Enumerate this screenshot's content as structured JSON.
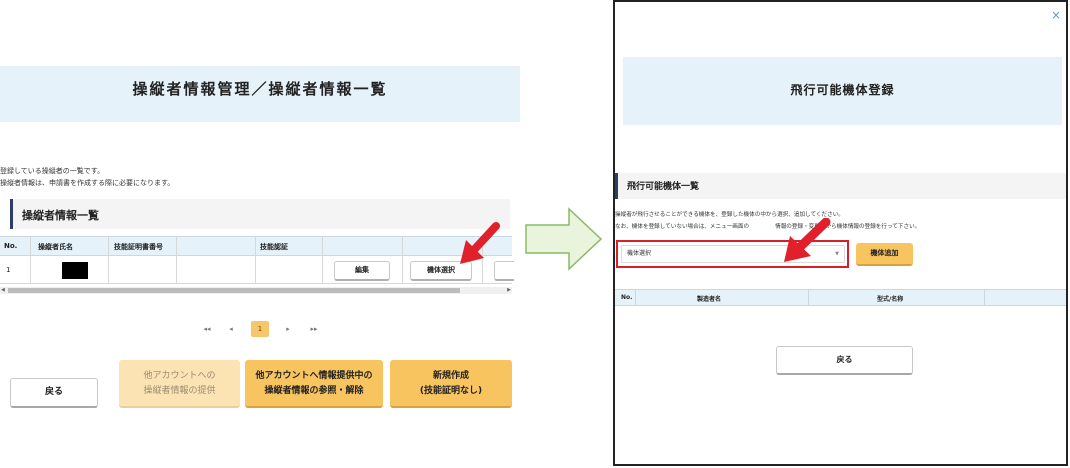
{
  "left": {
    "page_title": "操縦者情報管理／操縦者情報一覧",
    "description_line1": "登録している操縦者の一覧です。",
    "description_line2": "操縦者情報は、申請書を作成する際に必要になります。",
    "section_title": "操縦者情報一覧",
    "table": {
      "headers": [
        "No.",
        "操縦者氏名",
        "技能証明書番号",
        "技能認証"
      ],
      "rows": [
        {
          "no": "1",
          "name_redacted": true,
          "edit_label": "編集",
          "select_aircraft_label": "機体選択"
        }
      ]
    },
    "pagination": {
      "first": "◂◂",
      "prev": "◂",
      "current": "1",
      "next": "▸",
      "last": "▸▸"
    },
    "buttons": {
      "back": "戻る",
      "provide_line1": "他アカウントへの",
      "provide_line2": "操縦者情報の提供",
      "view_line1": "他アカウントへ情報提供中の",
      "view_line2": "操縦者情報の参照・解除",
      "new_line1": "新規作成",
      "new_line2": "(技能証明なし)"
    }
  },
  "modal": {
    "close": "×",
    "title": "飛行可能機体登録",
    "section_title": "飛行可能機体一覧",
    "description_line1": "操縦者が飛行させることができる機体を、登録した機体の中から選択、追加してください。",
    "description_line2a": "なお、機体を登録していない場合は、メニュー画面の",
    "description_line2b": "情報の登録・変更」から機体情報の登録を行って下さい。",
    "select_placeholder": "機体選択",
    "add_button": "機体追加",
    "table_headers": [
      "No.",
      "製造者名",
      "型式/名称"
    ],
    "back_button": "戻る"
  },
  "colors": {
    "title_band": "#e6f2fa",
    "accent_yellow": "#f7c460",
    "disabled_yellow": "#fbe3b3",
    "highlight_red": "#d8202a",
    "arrow_green_fill": "#e9f4dc",
    "arrow_green_stroke": "#8cb868"
  },
  "icons": {
    "close": "close-icon",
    "dropdown": "chevron-down-icon",
    "pointer": "red-arrow-icon",
    "transition": "right-arrow-icon"
  }
}
